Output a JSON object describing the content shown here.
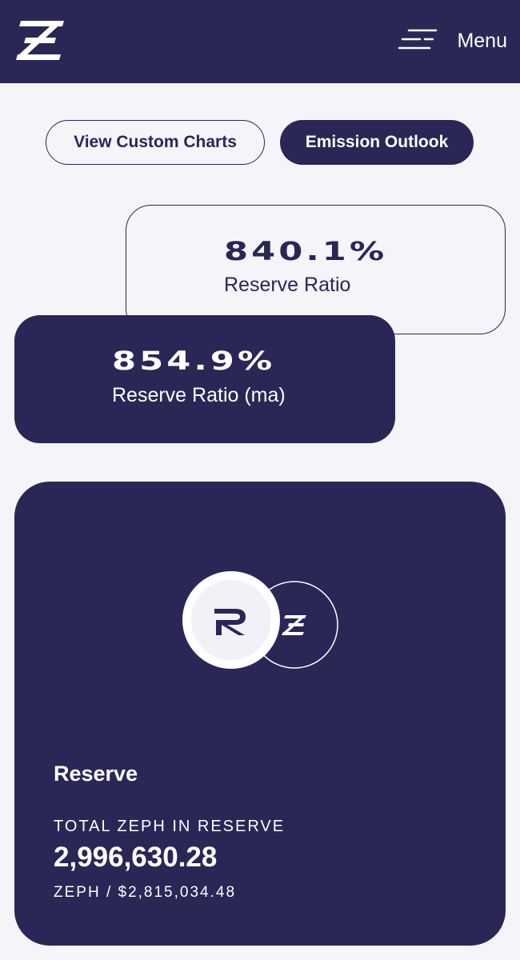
{
  "header": {
    "logo_icon": "zeph-z-logo-icon",
    "menu_icon": "hamburger-menu-icon",
    "menu_label": "Menu"
  },
  "actions": {
    "view_custom_charts": "View Custom Charts",
    "emission_outlook": "Emission Outlook"
  },
  "ratios": {
    "reserve_ratio": {
      "value": "840.1%",
      "label": "Reserve Ratio"
    },
    "reserve_ratio_ma": {
      "value": "854.9%",
      "label": "Reserve Ratio (ma)"
    }
  },
  "reserve": {
    "icons": [
      "zrsv-r-token-icon",
      "zeph-z-token-icon"
    ],
    "title": "Reserve",
    "subtitle": "TOTAL ZEPH IN RESERVE",
    "amount": "2,996,630.28",
    "usd_line": "ZEPH / $2,815,034.48"
  },
  "colors": {
    "primary": "#2a2757",
    "background": "#f4f4f9",
    "text_on_primary": "#ffffff"
  }
}
